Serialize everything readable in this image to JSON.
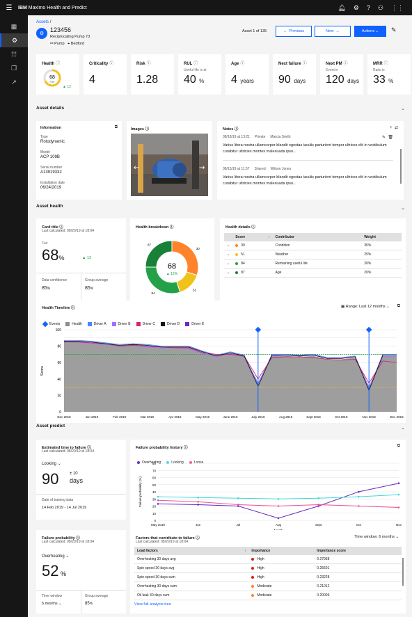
{
  "topbar": {
    "brand_a": "IBM",
    "brand_b": "Maximo Health and Predict"
  },
  "header": {
    "breadcrumb": "Assets",
    "breadcrumb_sep": "/",
    "asset_id": "123456",
    "asset_desc": "Reciprocating Pump 73",
    "type": "Pump",
    "location": "Bedford",
    "counter": "Asset 1 of 135",
    "prev": "Previous",
    "next": "Next",
    "actions": "Actions"
  },
  "kpis": {
    "health": {
      "label": "Health",
      "score": "68",
      "status": "Fair",
      "delta": "12",
      "ring_fraction": 0.68
    },
    "criticality": {
      "label": "Criticality",
      "value": "4"
    },
    "risk": {
      "label": "Risk",
      "value": "1.28"
    },
    "rul": {
      "label": "RUL",
      "sub": "Useful life is at",
      "value": "40",
      "unit": "%"
    },
    "age": {
      "label": "Age",
      "value": "4",
      "unit": "years"
    },
    "next_failure": {
      "label": "Next failure",
      "value": "90",
      "unit": "days"
    },
    "next_pm": {
      "label": "Next PM",
      "sub": "Event in",
      "value": "120",
      "unit": "days"
    },
    "mrr": {
      "label": "MRR",
      "sub": "Ratio is",
      "value": "33",
      "unit": "%"
    }
  },
  "asset_details": {
    "title": "Asset details",
    "info": {
      "title": "Information",
      "type_label": "Type",
      "type": "Rotodynamic",
      "model_label": "Model",
      "model": "ACP 109B",
      "serial_label": "Serial number",
      "serial": "A13919332",
      "install_label": "Installation date",
      "install": "06/24/2019"
    },
    "images_title": "Images",
    "notes": {
      "title": "Notes",
      "items": [
        {
          "date": "08/18/19 at 13:21",
          "visibility": "Private",
          "author": "Marcia Smith",
          "text": "Varius litora nostra ullamcorper blandit egestas iaculis parturient tempor ultrices elit in vestibulum curabitur ultricies montes malesuada ipsu..."
        },
        {
          "date": "08/15/19 at 11:57",
          "visibility": "Shared",
          "author": "Wilson Jones",
          "text": "Varius litora nostra ullamcorper blandit egestas iaculis parturient tempor ultrices elit in vestibulum curabitur ultricies montes malesuada ipsu..."
        }
      ]
    }
  },
  "asset_health": {
    "title": "Asset health",
    "card": {
      "title": "Card title",
      "calc": "Last calculated: 08/20/19 at 18:04",
      "status": "Fair",
      "value": "68",
      "unit": "%",
      "delta": "12",
      "conf_label": "Data confidence",
      "conf": "85",
      "conf_unit": "%",
      "group_label": "Group average",
      "group": "85",
      "group_unit": "%"
    },
    "breakdown": {
      "title": "Health breakdown",
      "center": "68",
      "delta": "12%",
      "segments": [
        {
          "label": "30",
          "value": 30,
          "color": "#ff832b"
        },
        {
          "label": "51",
          "value": 15,
          "color": "#f1c21b"
        },
        {
          "label": "84",
          "value": 30,
          "color": "#24a148"
        },
        {
          "label": "87",
          "value": 25,
          "color": "#198038"
        }
      ]
    },
    "details": {
      "title": "Health details",
      "cols": [
        "Score",
        "Contributor",
        "Weight"
      ],
      "rows": [
        {
          "score": "30",
          "contributor": "Condition",
          "weight": "35%",
          "color": "#ff832b"
        },
        {
          "score": "51",
          "contributor": "Weather",
          "weight": "25%",
          "color": "#f1c21b"
        },
        {
          "score": "84",
          "contributor": "Remaining useful life",
          "weight": "20%",
          "color": "#24a148"
        },
        {
          "score": "87",
          "contributor": "Age",
          "weight": "20%",
          "color": "#198038"
        }
      ]
    }
  },
  "timeline": {
    "title": "Health Timeline",
    "range": "Range: Last 12 months"
  },
  "asset_predict": {
    "title": "Asset predict",
    "ettf": {
      "title": "Estimated time to failure",
      "calc": "Last calculated: 08/20/19 at 18:04",
      "mode": "Looking",
      "value": "90",
      "pm": "± 10",
      "unit": "days",
      "train_label": "Date of training data",
      "train": "14 Feb 2019 - 14 Jul 2019"
    },
    "fph": {
      "title": "Failure probability history",
      "ylabel": "Failure probability (%)",
      "xlabel": "Month"
    },
    "fp": {
      "title": "Failure probability",
      "calc": "Last calculated: 08/20/19 at 18:04",
      "mode": "Overheating",
      "value": "52",
      "unit": "%",
      "window_label": "Time window",
      "window": "6 months",
      "group_label": "Group average",
      "group": "85",
      "group_unit": "%"
    },
    "factors": {
      "title": "Factors that contribute to failure",
      "calc": "Last calculated: 08/20/19 at 18:04",
      "window": "Time window: 6 months",
      "cols": [
        "Lead factors",
        "Importance",
        "Importance score"
      ],
      "rows": [
        {
          "factor": "Overheating 30 days avg",
          "importance": "High",
          "score": "0.27938",
          "color": "#da1e28"
        },
        {
          "factor": "Spin speed 30 days avg",
          "importance": "High",
          "score": "0.25501",
          "color": "#da1e28"
        },
        {
          "factor": "Spin speed 30 days sum",
          "importance": "High",
          "score": "0.23228",
          "color": "#da1e28"
        },
        {
          "factor": "Overheating 30 days sum",
          "importance": "Moderate",
          "score": "0.21012",
          "color": "#ff832b"
        },
        {
          "factor": "Oil leak 30 days sum",
          "importance": "Moderate",
          "score": "0.20009",
          "color": "#ff832b"
        }
      ],
      "link": "View full analysis tree"
    }
  },
  "chart_data": [
    {
      "type": "area",
      "title": "Health Timeline",
      "ylabel": "Score",
      "ylim": [
        0,
        100
      ],
      "yticks": [
        0,
        10,
        20,
        30,
        40,
        50,
        60,
        70,
        80,
        90,
        100
      ],
      "categories": [
        "Dec 2018",
        "Jan 2019",
        "Feb 2019",
        "Mar 2019",
        "Apr 2019",
        "May 2019",
        "June 2019",
        "July 2019",
        "Aug 2019",
        "Sept 2019",
        "Oct 2019",
        "Nov 2019",
        "Dec 2019"
      ],
      "legend": [
        "Events",
        "Health",
        "Driver A",
        "Driver B",
        "Driver C",
        "Driver D",
        "Driver E"
      ],
      "legend_colors": [
        "#0f62fe",
        "#8d8d8d",
        "#4589ff",
        "#a56eff",
        "#d12771",
        "#161616",
        "#6929c4"
      ],
      "series": [
        {
          "name": "Health",
          "color": "#8d8d8d",
          "values": [
            86,
            86,
            84,
            83,
            80,
            82,
            80,
            79,
            79,
            79,
            72,
            68,
            72,
            68,
            30,
            68,
            68,
            67,
            68,
            64,
            64,
            66,
            25,
            68,
            68
          ]
        },
        {
          "name": "Driver A",
          "color": "#4589ff",
          "values": [
            87,
            87,
            86,
            84,
            82,
            83,
            82,
            80,
            80,
            80,
            74,
            69,
            73,
            69,
            33,
            70,
            70,
            69,
            70,
            66,
            66,
            68,
            28,
            70,
            70
          ]
        },
        {
          "name": "Driver B",
          "color": "#a56eff",
          "values": [
            86,
            85,
            83,
            82,
            80,
            81,
            79,
            78,
            78,
            77,
            71,
            67,
            71,
            67,
            35,
            68,
            69,
            68,
            69,
            65,
            66,
            67,
            30,
            67,
            67
          ]
        },
        {
          "name": "Driver C",
          "color": "#d12771",
          "values": [
            85,
            85,
            84,
            83,
            80,
            81,
            80,
            79,
            78,
            78,
            72,
            70,
            70,
            68,
            40,
            66,
            67,
            67,
            66,
            64,
            63,
            64,
            35,
            62,
            60
          ]
        },
        {
          "name": "Driver D",
          "color": "#161616",
          "values": [
            86,
            86,
            85,
            83,
            81,
            82,
            81,
            79,
            79,
            79,
            73,
            68,
            72,
            68,
            31,
            69,
            69,
            68,
            69,
            65,
            65,
            67,
            26,
            69,
            69
          ]
        }
      ],
      "thresholds": [
        {
          "value": 70,
          "color": "#24a148"
        },
        {
          "value": 30,
          "color": "#f1c21b"
        }
      ],
      "events": [
        {
          "index": 14
        },
        {
          "index": 22
        }
      ]
    },
    {
      "type": "line",
      "title": "Failure probability history",
      "ylabel": "Failure probability (%)",
      "xlabel": "Month",
      "ylim": [
        0,
        80
      ],
      "yticks": [
        0,
        10,
        20,
        30,
        40,
        50,
        60,
        70,
        80
      ],
      "categories": [
        "May 2019",
        "Jun",
        "Jul",
        "Aug",
        "Sept",
        "Oct",
        "Nov"
      ],
      "series": [
        {
          "name": "Overheating",
          "color": "#6929c4",
          "values": [
            23,
            22,
            20,
            3,
            20,
            40,
            52
          ]
        },
        {
          "name": "Looking",
          "color": "#3ddbd9",
          "values": [
            33,
            32,
            31,
            30,
            31,
            33,
            36
          ]
        },
        {
          "name": "Loose",
          "color": "#ee5396",
          "values": [
            28,
            26,
            22,
            20,
            22,
            20,
            18
          ]
        }
      ]
    }
  ]
}
